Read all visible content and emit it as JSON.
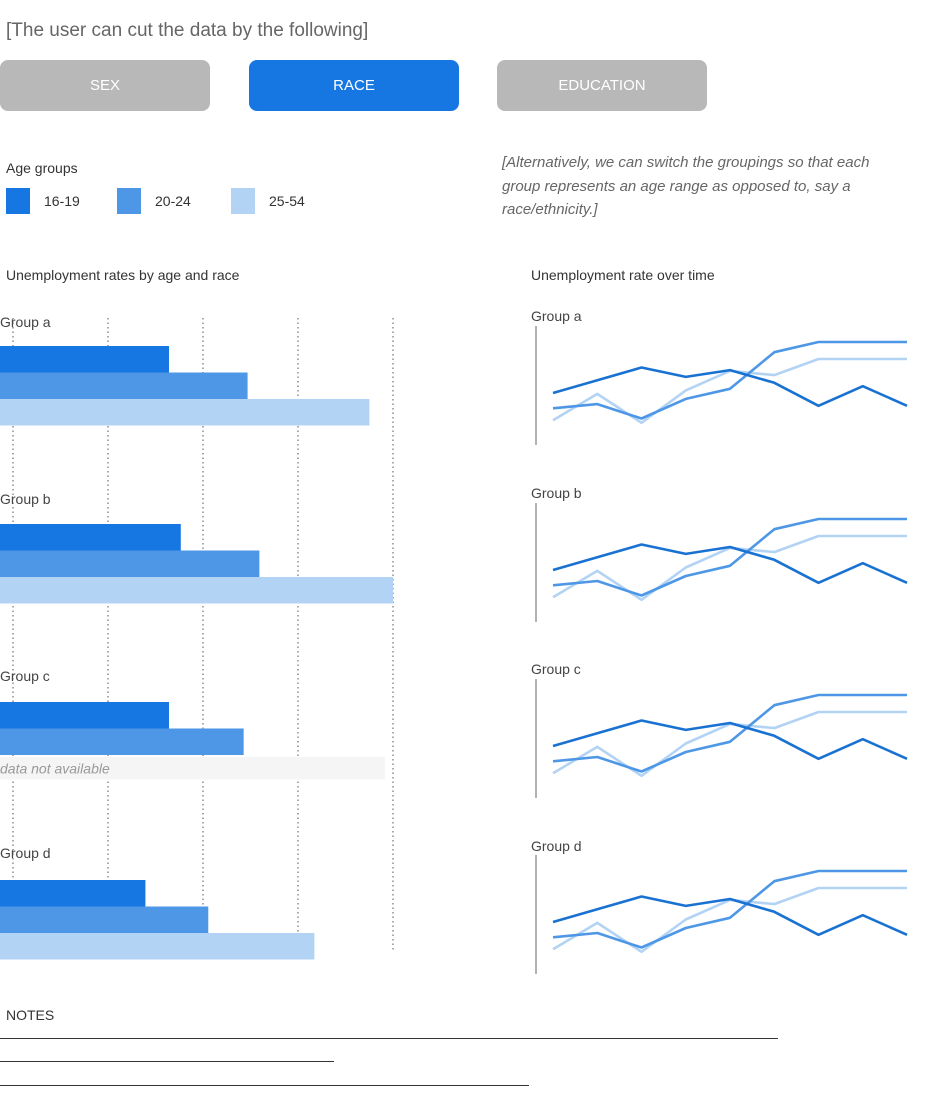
{
  "header": {
    "instruction": "[The user can cut the data by the following]"
  },
  "tabs": [
    {
      "label": "SEX",
      "active": false
    },
    {
      "label": "RACE",
      "active": true
    },
    {
      "label": "EDUCATION",
      "active": false
    }
  ],
  "legend": {
    "title": "Age groups",
    "items": [
      {
        "label": "16-19",
        "color": "#1677e3"
      },
      {
        "label": "20-24",
        "color": "#4e97e6"
      },
      {
        "label": "25-54",
        "color": "#b3d3f5"
      }
    ]
  },
  "alt_note": "[Alternatively, we can switch the groupings so that each group represents an age range as opposed to, say a race/ethnicity.]",
  "colors": {
    "accent": "#1677e3",
    "inactive_tab": "#b8b8b8",
    "na_fill": "#f5f5f5"
  },
  "chart_data": [
    {
      "type": "bar",
      "orientation": "horizontal",
      "title": "Unemployment rates by age and race",
      "grid": "vertical dotted lines",
      "na_label": "data not available",
      "groups": [
        {
          "label": "Group a",
          "values": [
            43,
            63,
            94
          ]
        },
        {
          "label": "Group b",
          "values": [
            46,
            66,
            100
          ]
        },
        {
          "label": "Group c",
          "values": [
            43,
            62,
            null
          ]
        },
        {
          "label": "Group d",
          "values": [
            37,
            53,
            80
          ]
        }
      ],
      "series": [
        "16-19",
        "20-24",
        "25-54"
      ],
      "xlim": [
        0,
        100
      ]
    },
    {
      "type": "line",
      "title": "Unemployment rate over time",
      "ylim": [
        0,
        100
      ],
      "groups": [
        {
          "label": "Group a",
          "series": [
            {
              "values": [
                40,
                55,
                70,
                59,
                67,
                52,
                25,
                48,
                25
              ]
            },
            {
              "values": [
                22,
                27,
                10,
                33,
                45,
                88,
                100,
                100,
                100
              ]
            },
            {
              "values": [
                8,
                39,
                5,
                43,
                66,
                61,
                80,
                80,
                80
              ]
            }
          ]
        },
        {
          "label": "Group b",
          "series": [
            {
              "values": [
                40,
                55,
                70,
                59,
                67,
                52,
                25,
                48,
                25
              ]
            },
            {
              "values": [
                22,
                27,
                10,
                33,
                45,
                88,
                100,
                100,
                100
              ]
            },
            {
              "values": [
                8,
                39,
                5,
                43,
                66,
                61,
                80,
                80,
                80
              ]
            }
          ]
        },
        {
          "label": "Group c",
          "series": [
            {
              "values": [
                40,
                55,
                70,
                59,
                67,
                52,
                25,
                48,
                25
              ]
            },
            {
              "values": [
                22,
                27,
                10,
                33,
                45,
                88,
                100,
                100,
                100
              ]
            },
            {
              "values": [
                8,
                39,
                5,
                43,
                66,
                61,
                80,
                80,
                80
              ]
            }
          ]
        },
        {
          "label": "Group d",
          "series": [
            {
              "values": [
                40,
                55,
                70,
                59,
                67,
                52,
                25,
                48,
                25
              ]
            },
            {
              "values": [
                22,
                27,
                10,
                33,
                45,
                88,
                100,
                100,
                100
              ]
            },
            {
              "values": [
                8,
                39,
                5,
                43,
                66,
                61,
                80,
                80,
                80
              ]
            }
          ]
        }
      ]
    }
  ],
  "notes": {
    "title": "NOTES"
  }
}
